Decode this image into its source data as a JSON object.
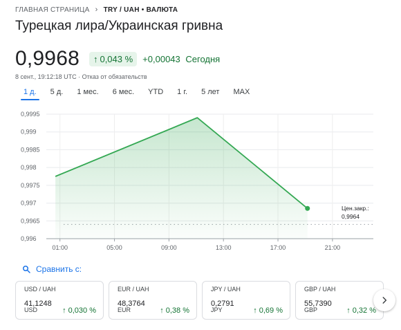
{
  "breadcrumb": {
    "home": "ГЛАВНАЯ СТРАНИЦА",
    "current": "TRY / UAH • ВАЛЮТА"
  },
  "title": "Турецкая лира/Украинская гривна",
  "price": "0,9968",
  "change_pct": "0,043 %",
  "change_abs": "+0,00043",
  "change_period": "Сегодня",
  "meta": "8 сент., 19:12:18 UTC · Отказ от обязательств",
  "ranges": [
    "1 д.",
    "5 д.",
    "1 мес.",
    "6 мес.",
    "YTD",
    "1 г.",
    "5 лет",
    "MAX"
  ],
  "active_range": 0,
  "chart_data": {
    "type": "area",
    "x": [
      "00:40",
      "11:05",
      "19:10"
    ],
    "y": [
      0.99775,
      0.9994,
      0.99685
    ],
    "x_ticks": [
      "01:00",
      "05:00",
      "09:00",
      "13:00",
      "17:00",
      "21:00"
    ],
    "y_ticks": [
      "0,9995",
      "0,999",
      "0,9985",
      "0,998",
      "0,9975",
      "0,997",
      "0,9965",
      "0,996"
    ],
    "ylim": [
      0.996,
      0.9995
    ],
    "prev_close_label": "Цен.закр.:",
    "prev_close_value": "0,9964",
    "prev_close": 0.9964,
    "line_color": "#34a853",
    "grid": true
  },
  "compare_label": "Сравнить с:",
  "cards": [
    {
      "pair": "USD / UAH",
      "value": "41,1248",
      "code": "USD",
      "change": "0,030 %"
    },
    {
      "pair": "EUR / UAH",
      "value": "48,3764",
      "code": "EUR",
      "change": "0,38 %"
    },
    {
      "pair": "JPY / UAH",
      "value": "0,2791",
      "code": "JPY",
      "change": "0,69 %"
    },
    {
      "pair": "GBP / UAH",
      "value": "55,7390",
      "code": "GBP",
      "change": "0,32 %"
    }
  ],
  "colors": {
    "positive": "#137333",
    "accent": "#1a73e8",
    "chart_line": "#34a853"
  },
  "icons": {
    "breadcrumb_sep": "chevron-right-icon",
    "compare": "search-icon",
    "next": "chevron-right-icon",
    "up": "arrow-up-icon"
  }
}
